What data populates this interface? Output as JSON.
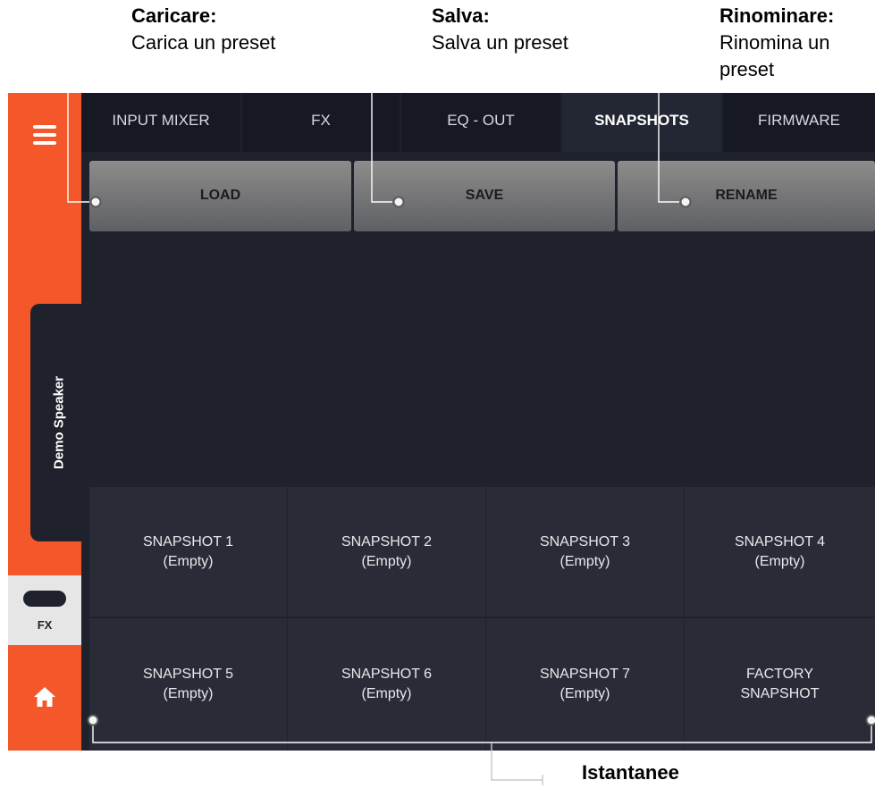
{
  "callouts": {
    "load": {
      "title": "Caricare:",
      "desc": "Carica un preset"
    },
    "save": {
      "title": "Salva:",
      "desc": "Salva un preset"
    },
    "rename": {
      "title": "Rinominare:",
      "desc": "Rinomina un preset"
    },
    "snapshots": {
      "title": "Istantanee"
    }
  },
  "sidebar": {
    "device_label": "Demo Speaker",
    "fx_label": "FX",
    "icons": [
      "menu-icon",
      "home-icon"
    ]
  },
  "tabs": [
    {
      "label": "INPUT MIXER"
    },
    {
      "label": "FX"
    },
    {
      "label": "EQ - OUT"
    },
    {
      "label": "SNAPSHOTS",
      "active": true
    },
    {
      "label": "FIRMWARE"
    }
  ],
  "actions": {
    "load_label": "LOAD",
    "save_label": "SAVE",
    "rename_label": "RENAME"
  },
  "snapshots": [
    {
      "line1": "SNAPSHOT 1",
      "line2": "(Empty)"
    },
    {
      "line1": "SNAPSHOT 2",
      "line2": "(Empty)"
    },
    {
      "line1": "SNAPSHOT 3",
      "line2": "(Empty)"
    },
    {
      "line1": "SNAPSHOT 4",
      "line2": "(Empty)"
    },
    {
      "line1": "SNAPSHOT 5",
      "line2": "(Empty)"
    },
    {
      "line1": "SNAPSHOT 6",
      "line2": "(Empty)"
    },
    {
      "line1": "SNAPSHOT 7",
      "line2": "(Empty)"
    },
    {
      "line1": "FACTORY",
      "line2": "SNAPSHOT"
    }
  ],
  "colors": {
    "accent": "#f4582a",
    "background": "#1f222c",
    "tab_bg": "#161923",
    "cell_bg": "#292c36",
    "button_gray": "#7a7b7f"
  }
}
